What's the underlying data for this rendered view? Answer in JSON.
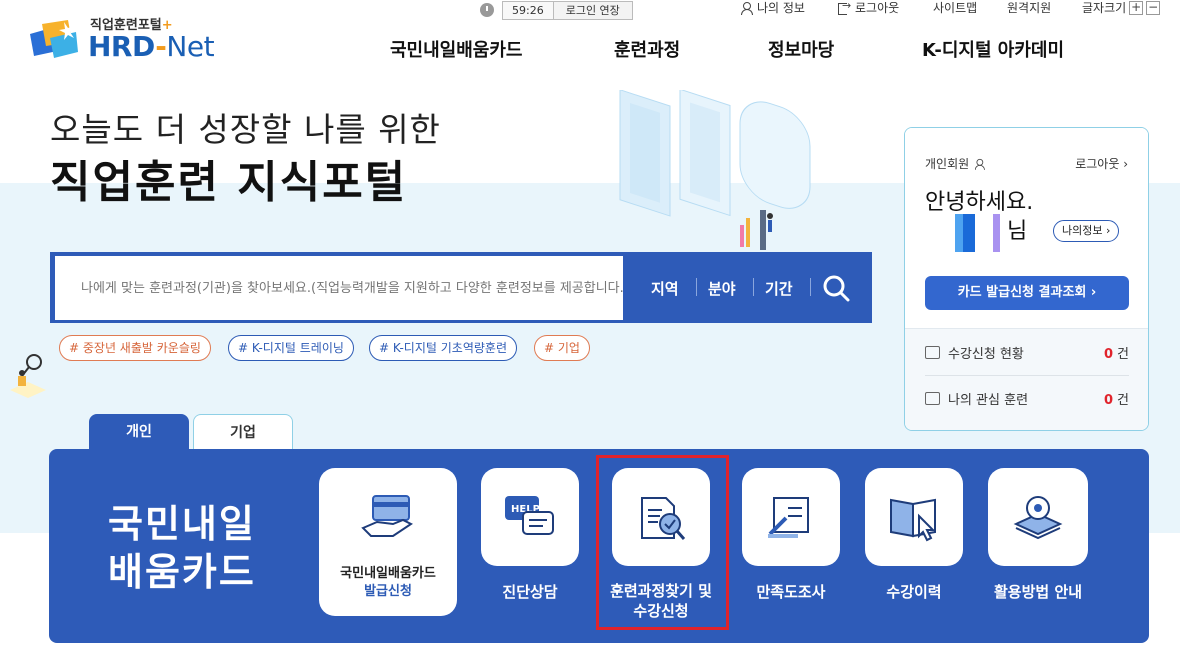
{
  "logo": {
    "subtitle": "직업훈련포털",
    "plus": "+",
    "brand_hrd": "HRD",
    "brand_dash": "-",
    "brand_net": "Net"
  },
  "util": {
    "timer": "59:26",
    "extend_label": "로그인 연장",
    "my_info": "나의 정보",
    "logout": "로그아웃",
    "sitemap": "사이트맵",
    "remote_support": "원격지원",
    "font_size": "글자크기",
    "font_plus": "+",
    "font_minus": "−"
  },
  "gnb": [
    "국민내일배움카드",
    "훈련과정",
    "정보마당",
    "K-디지털 아카데미"
  ],
  "hero": {
    "line1": "오늘도 더 성장할 나를 위한",
    "line2": "직업훈련 지식포털"
  },
  "search": {
    "placeholder": "나에게 맞는 훈련과정(기관)을 찾아보세요.(직업능력개발을 지원하고 다양한 훈련정보를 제공합니다.)",
    "filters": [
      "지역",
      "분야",
      "기간"
    ]
  },
  "tags": [
    "# 중장년 새출발 카운슬링",
    "# K-디지털 트레이닝",
    "# K-디지털 기초역량훈련",
    "# 기업"
  ],
  "panel": {
    "member_type": "개인회원",
    "logout": "로그아웃 ›",
    "greeting": "안녕하세요.",
    "nim": "님",
    "my_info_btn": "나의정보 ›",
    "card_btn": "카드 발급신청 결과조회  ›",
    "stats": [
      {
        "label": "수강신청 현황",
        "count": "0",
        "unit": "건"
      },
      {
        "label": "나의 관심 훈련",
        "count": "0",
        "unit": "건"
      }
    ]
  },
  "tabs": [
    "개인",
    "기업"
  ],
  "quick": {
    "title_line1": "국민내일",
    "title_line2": "배움카드",
    "card": {
      "line1": "국민내일배움카드",
      "line2": "발급신청"
    },
    "items": [
      {
        "label": "진단상담",
        "icon": "help-chat-icon"
      },
      {
        "label": "훈련과정찾기 및\n수강신청",
        "icon": "document-search-icon"
      },
      {
        "label": "만족도조사",
        "icon": "survey-pen-icon"
      },
      {
        "label": "수강이력",
        "icon": "book-cursor-icon"
      },
      {
        "label": "활용방법 안내",
        "icon": "gear-stack-icon"
      }
    ]
  },
  "colors": {
    "primary": "#2e5bb8",
    "accent": "#f29b1d",
    "alert": "#e0232b",
    "band": "#e9f5fb"
  }
}
